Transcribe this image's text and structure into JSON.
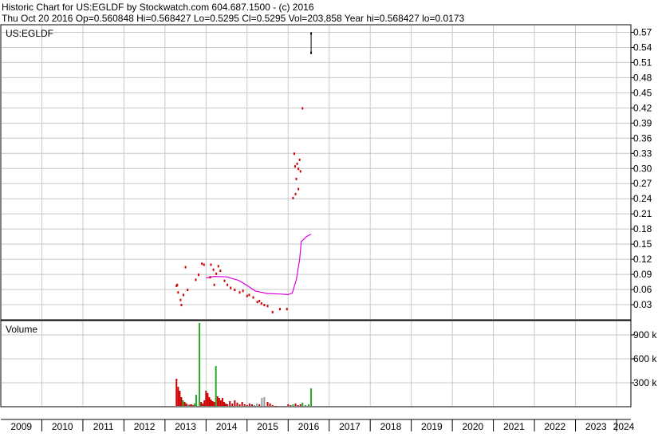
{
  "header": {
    "line1": "Historic Chart for US:EGLDF by Stockwatch.com 604.687.1500 - (c) 2016",
    "line2": "Thu Oct 20 2016   Op=0.560848   Hi=0.568427   Lo=0.5295   Cl=0.5295   Vol=203,858   Year hi=0.568427   lo=0.0173"
  },
  "colors": {
    "price": "#cc0000",
    "moving_average": "#dd00dd",
    "volume_up": "#22aa22",
    "volume_down": "#cc0000",
    "volume_neutral": "#999999",
    "grid": "#c8c8c8"
  },
  "chart_data": [
    {
      "type": "scatter",
      "title": "US:EGLDF",
      "ylim": [
        0,
        0.585
      ],
      "x_range": [
        2009,
        2024.35
      ],
      "grid": true,
      "y_ticks": [
        "0.57",
        "0.54",
        "0.51",
        "0.48",
        "0.45",
        "0.42",
        "0.39",
        "0.36",
        "0.33",
        "0.30",
        "0.27",
        "0.24",
        "0.21",
        "0.18",
        "0.15",
        "0.12",
        "0.09",
        "0.06",
        "0.03"
      ],
      "series": [
        {
          "points": [
            [
              2013.28,
              0.068
            ],
            [
              2013.3,
              0.07
            ],
            [
              2013.32,
              0.055
            ],
            [
              2013.38,
              0.04
            ],
            [
              2013.4,
              0.03
            ],
            [
              2013.45,
              0.05
            ],
            [
              2013.5,
              0.105
            ],
            [
              2013.55,
              0.06
            ],
            [
              2013.75,
              0.08
            ],
            [
              2013.82,
              0.09
            ],
            [
              2013.9,
              0.112
            ],
            [
              2013.95,
              0.11
            ],
            [
              2014.1,
              0.085
            ],
            [
              2014.12,
              0.11
            ],
            [
              2014.18,
              0.1
            ],
            [
              2014.2,
              0.07
            ],
            [
              2014.25,
              0.092
            ],
            [
              2014.3,
              0.107
            ],
            [
              2014.35,
              0.098
            ],
            [
              2014.45,
              0.078
            ],
            [
              2014.52,
              0.07
            ],
            [
              2014.6,
              0.064
            ],
            [
              2014.7,
              0.06
            ],
            [
              2014.82,
              0.055
            ],
            [
              2014.9,
              0.058
            ],
            [
              2015.0,
              0.048
            ],
            [
              2015.05,
              0.05
            ],
            [
              2015.15,
              0.045
            ],
            [
              2015.25,
              0.036
            ],
            [
              2015.3,
              0.038
            ],
            [
              2015.35,
              0.033
            ],
            [
              2015.42,
              0.03
            ],
            [
              2015.5,
              0.028
            ],
            [
              2015.62,
              0.016
            ],
            [
              2015.8,
              0.022
            ],
            [
              2015.97,
              0.022
            ],
            [
              2016.12,
              0.242
            ],
            [
              2016.18,
              0.25
            ],
            [
              2016.25,
              0.26
            ],
            [
              2016.15,
              0.33
            ],
            [
              2016.17,
              0.305
            ],
            [
              2016.22,
              0.31
            ],
            [
              2016.25,
              0.3
            ],
            [
              2016.28,
              0.318
            ],
            [
              2016.2,
              0.28
            ],
            [
              2016.3,
              0.295
            ],
            [
              2016.35,
              0.42
            ],
            [
              2016.56,
              0.53
            ],
            [
              2016.56,
              0.568427
            ]
          ]
        },
        {
          "type": "line",
          "points": [
            [
              2014.0,
              0.083
            ],
            [
              2014.2,
              0.086
            ],
            [
              2014.5,
              0.085
            ],
            [
              2014.8,
              0.078
            ],
            [
              2015.0,
              0.068
            ],
            [
              2015.2,
              0.057
            ],
            [
              2015.5,
              0.052
            ],
            [
              2015.8,
              0.051
            ],
            [
              2016.0,
              0.05
            ],
            [
              2016.1,
              0.053
            ],
            [
              2016.2,
              0.08
            ],
            [
              2016.28,
              0.12
            ],
            [
              2016.32,
              0.155
            ],
            [
              2016.45,
              0.165
            ],
            [
              2016.56,
              0.17
            ]
          ]
        }
      ]
    },
    {
      "type": "bar",
      "title": "Volume",
      "ylim": [
        0,
        1080000
      ],
      "x_range": [
        2009,
        2024.35
      ],
      "y_ticks": [
        "900 k",
        "600 k",
        "300 k"
      ],
      "bars": [
        [
          2013.28,
          350000,
          "down"
        ],
        [
          2013.32,
          250000,
          "down"
        ],
        [
          2013.36,
          200000,
          "down"
        ],
        [
          2013.4,
          120000,
          "down"
        ],
        [
          2013.44,
          80000,
          "up"
        ],
        [
          2013.48,
          60000,
          "down"
        ],
        [
          2013.52,
          40000,
          "down"
        ],
        [
          2013.56,
          30000,
          "neutral"
        ],
        [
          2013.6,
          25000,
          "down"
        ],
        [
          2013.64,
          30000,
          "down"
        ],
        [
          2013.68,
          20000,
          "down"
        ],
        [
          2013.72,
          40000,
          "up"
        ],
        [
          2013.76,
          150000,
          "up"
        ],
        [
          2013.84,
          1050000,
          "up"
        ],
        [
          2013.88,
          60000,
          "down"
        ],
        [
          2013.92,
          40000,
          "down"
        ],
        [
          2013.96,
          80000,
          "down"
        ],
        [
          2014.0,
          200000,
          "down"
        ],
        [
          2014.04,
          170000,
          "down"
        ],
        [
          2014.08,
          120000,
          "down"
        ],
        [
          2014.12,
          90000,
          "down"
        ],
        [
          2014.16,
          70000,
          "down"
        ],
        [
          2014.2,
          60000,
          "down"
        ],
        [
          2014.24,
          510000,
          "up"
        ],
        [
          2014.28,
          130000,
          "down"
        ],
        [
          2014.32,
          110000,
          "down"
        ],
        [
          2014.36,
          80000,
          "down"
        ],
        [
          2014.4,
          110000,
          "down"
        ],
        [
          2014.44,
          60000,
          "down"
        ],
        [
          2014.48,
          40000,
          "down"
        ],
        [
          2014.52,
          30000,
          "down"
        ],
        [
          2014.58,
          70000,
          "down"
        ],
        [
          2014.64,
          40000,
          "down"
        ],
        [
          2014.7,
          80000,
          "down"
        ],
        [
          2014.76,
          50000,
          "down"
        ],
        [
          2014.82,
          30000,
          "down"
        ],
        [
          2014.88,
          60000,
          "down"
        ],
        [
          2014.94,
          30000,
          "down"
        ],
        [
          2015.0,
          20000,
          "down"
        ],
        [
          2015.06,
          40000,
          "down"
        ],
        [
          2015.12,
          30000,
          "down"
        ],
        [
          2015.18,
          20000,
          "neutral"
        ],
        [
          2015.24,
          40000,
          "neutral"
        ],
        [
          2015.3,
          30000,
          "down"
        ],
        [
          2015.36,
          110000,
          "neutral"
        ],
        [
          2015.42,
          120000,
          "neutral"
        ],
        [
          2015.5,
          60000,
          "down"
        ],
        [
          2015.56,
          40000,
          "down"
        ],
        [
          2015.62,
          20000,
          "down"
        ],
        [
          2015.7,
          10000,
          "down"
        ],
        [
          2016.0,
          30000,
          "down"
        ],
        [
          2016.06,
          20000,
          "down"
        ],
        [
          2016.12,
          30000,
          "up"
        ],
        [
          2016.18,
          40000,
          "down"
        ],
        [
          2016.24,
          20000,
          "down"
        ],
        [
          2016.3,
          30000,
          "down"
        ],
        [
          2016.35,
          50000,
          "up"
        ],
        [
          2016.42,
          20000,
          "up"
        ],
        [
          2016.5,
          30000,
          "up"
        ],
        [
          2016.56,
          230000,
          "up"
        ]
      ]
    }
  ],
  "x_axis": {
    "labels": [
      "2009",
      "2010",
      "2011",
      "2012",
      "2013",
      "2014",
      "2015",
      "2016",
      "2017",
      "2018",
      "2019",
      "2020",
      "2021",
      "2022",
      "2023",
      "2024"
    ]
  }
}
